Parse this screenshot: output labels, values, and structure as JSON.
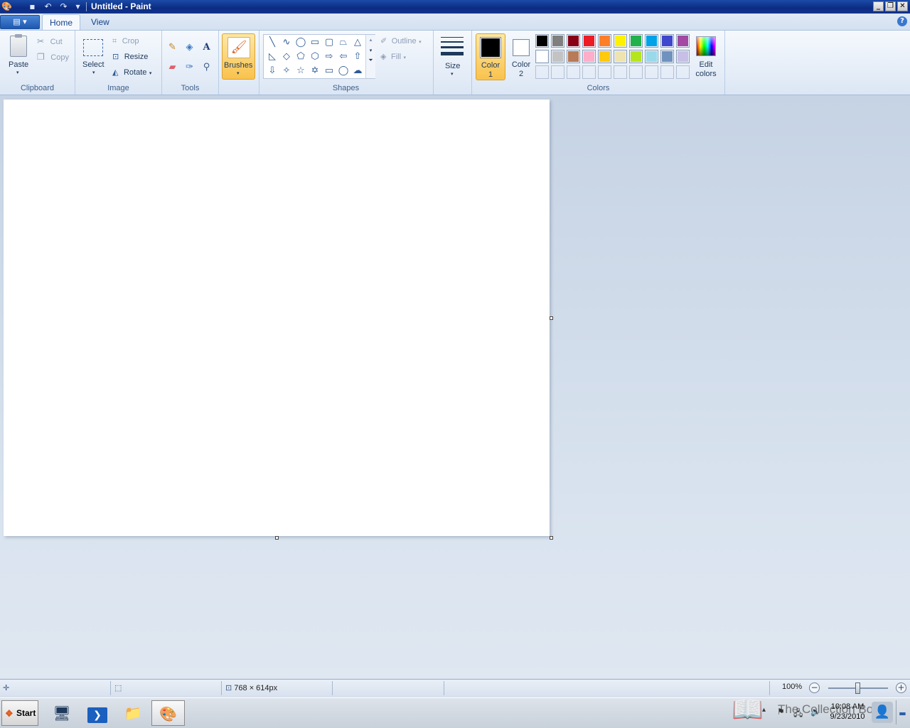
{
  "window": {
    "title": "Untitled - Paint",
    "app_icon": "paint-palette-icon",
    "quick_access": [
      "save-icon",
      "undo-icon",
      "redo-icon",
      "customize-dropdown-icon"
    ],
    "controls": [
      "minimize-icon",
      "restore-icon",
      "close-icon"
    ]
  },
  "ribbon": {
    "tabs": [
      {
        "label": "Home",
        "active": true
      },
      {
        "label": "View",
        "active": false
      }
    ],
    "help_icon": "help-icon",
    "clipboard": {
      "group_label": "Clipboard",
      "paste": "Paste",
      "cut": "Cut",
      "copy": "Copy"
    },
    "image": {
      "group_label": "Image",
      "select": "Select",
      "crop": "Crop",
      "resize": "Resize",
      "rotate": "Rotate"
    },
    "tools": {
      "group_label": "Tools",
      "items": [
        "pencil-icon",
        "fill-bucket-icon",
        "text-icon",
        "eraser-icon",
        "color-picker-icon",
        "magnifier-icon"
      ]
    },
    "brushes": {
      "label": "Brushes"
    },
    "shapes": {
      "group_label": "Shapes",
      "outline": "Outline",
      "fill": "Fill",
      "items": [
        "line",
        "curve",
        "oval",
        "rectangle",
        "rounded-rectangle",
        "polygon",
        "triangle",
        "right-triangle",
        "diamond",
        "pentagon",
        "hexagon",
        "right-arrow",
        "left-arrow",
        "up-arrow",
        "down-arrow",
        "four-point-star",
        "five-point-star",
        "six-point-star",
        "rounded-rectangular-callout",
        "oval-callout",
        "cloud-callout"
      ]
    },
    "size": {
      "label": "Size"
    },
    "colors": {
      "group_label": "Colors",
      "color1": {
        "label1": "Color",
        "label2": "1",
        "value": "#000000"
      },
      "color2": {
        "label1": "Color",
        "label2": "2",
        "value": "#ffffff"
      },
      "palette_row1": [
        "#000000",
        "#7f7f7f",
        "#880015",
        "#ed1c24",
        "#ff7f27",
        "#fff200",
        "#22b14c",
        "#00a2e8",
        "#3f48cc",
        "#a349a4"
      ],
      "palette_row2": [
        "#ffffff",
        "#c3c3c3",
        "#b97a57",
        "#ffaec9",
        "#ffc90e",
        "#efe4b0",
        "#b5e61d",
        "#99d9ea",
        "#7092be",
        "#c8bfe7"
      ],
      "palette_row3_empty": 10,
      "edit_colors": {
        "label1": "Edit",
        "label2": "colors"
      }
    }
  },
  "statusbar": {
    "canvas_size": "768 × 614px",
    "zoom": "100%",
    "zoom_level": 0.5
  },
  "taskbar": {
    "start": "Start",
    "clock_time": "10:08 AM",
    "clock_date": "9/23/2010",
    "watermark": "The Collection Book"
  }
}
